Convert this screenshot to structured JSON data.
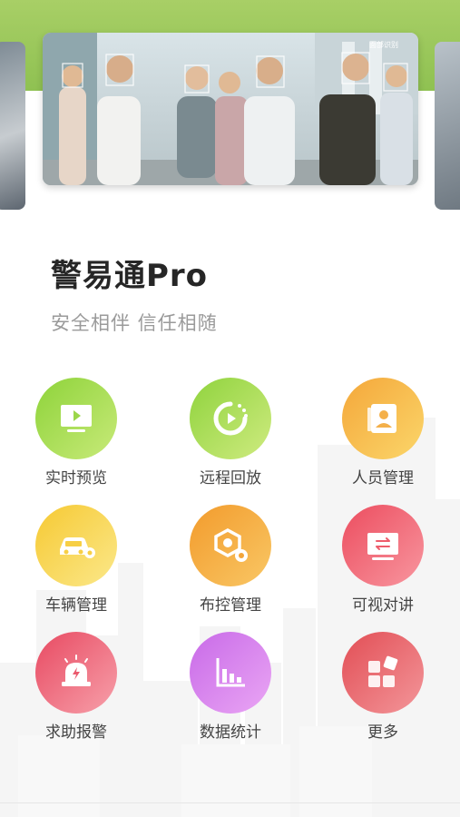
{
  "app": {
    "title": "警易通Pro",
    "slogan": "安全相伴 信任相随"
  },
  "banner": {
    "overlay_text": "面部识别"
  },
  "colors": {
    "header_green": "#9ac85a",
    "title": "#262626",
    "subtitle": "#9a9a9a"
  },
  "menu": [
    {
      "label": "实时预览",
      "icon": "monitor-play-icon",
      "gradient": [
        "#8ed33a",
        "#c8ea79"
      ]
    },
    {
      "label": "远程回放",
      "icon": "playback-icon",
      "gradient": [
        "#8fd33d",
        "#cfeb80"
      ]
    },
    {
      "label": "人员管理",
      "icon": "person-card-icon",
      "gradient": [
        "#f4a73a",
        "#fbd66a"
      ]
    },
    {
      "label": "车辆管理",
      "icon": "car-gear-icon",
      "gradient": [
        "#f6c933",
        "#fbe88a"
      ]
    },
    {
      "label": "布控管理",
      "icon": "hexagon-gear-icon",
      "gradient": [
        "#f29b2c",
        "#f9c765"
      ]
    },
    {
      "label": "可视对讲",
      "icon": "intercom-screen-icon",
      "gradient": [
        "#ec4d5f",
        "#f8969f"
      ]
    },
    {
      "label": "求助报警",
      "icon": "alarm-light-icon",
      "gradient": [
        "#e84a62",
        "#f7a0aa"
      ]
    },
    {
      "label": "数据统计",
      "icon": "bar-chart-icon",
      "gradient": [
        "#c86ae8",
        "#eaa6f4"
      ]
    },
    {
      "label": "更多",
      "icon": "more-apps-icon",
      "gradient": [
        "#e24e55",
        "#f3969a"
      ]
    }
  ]
}
